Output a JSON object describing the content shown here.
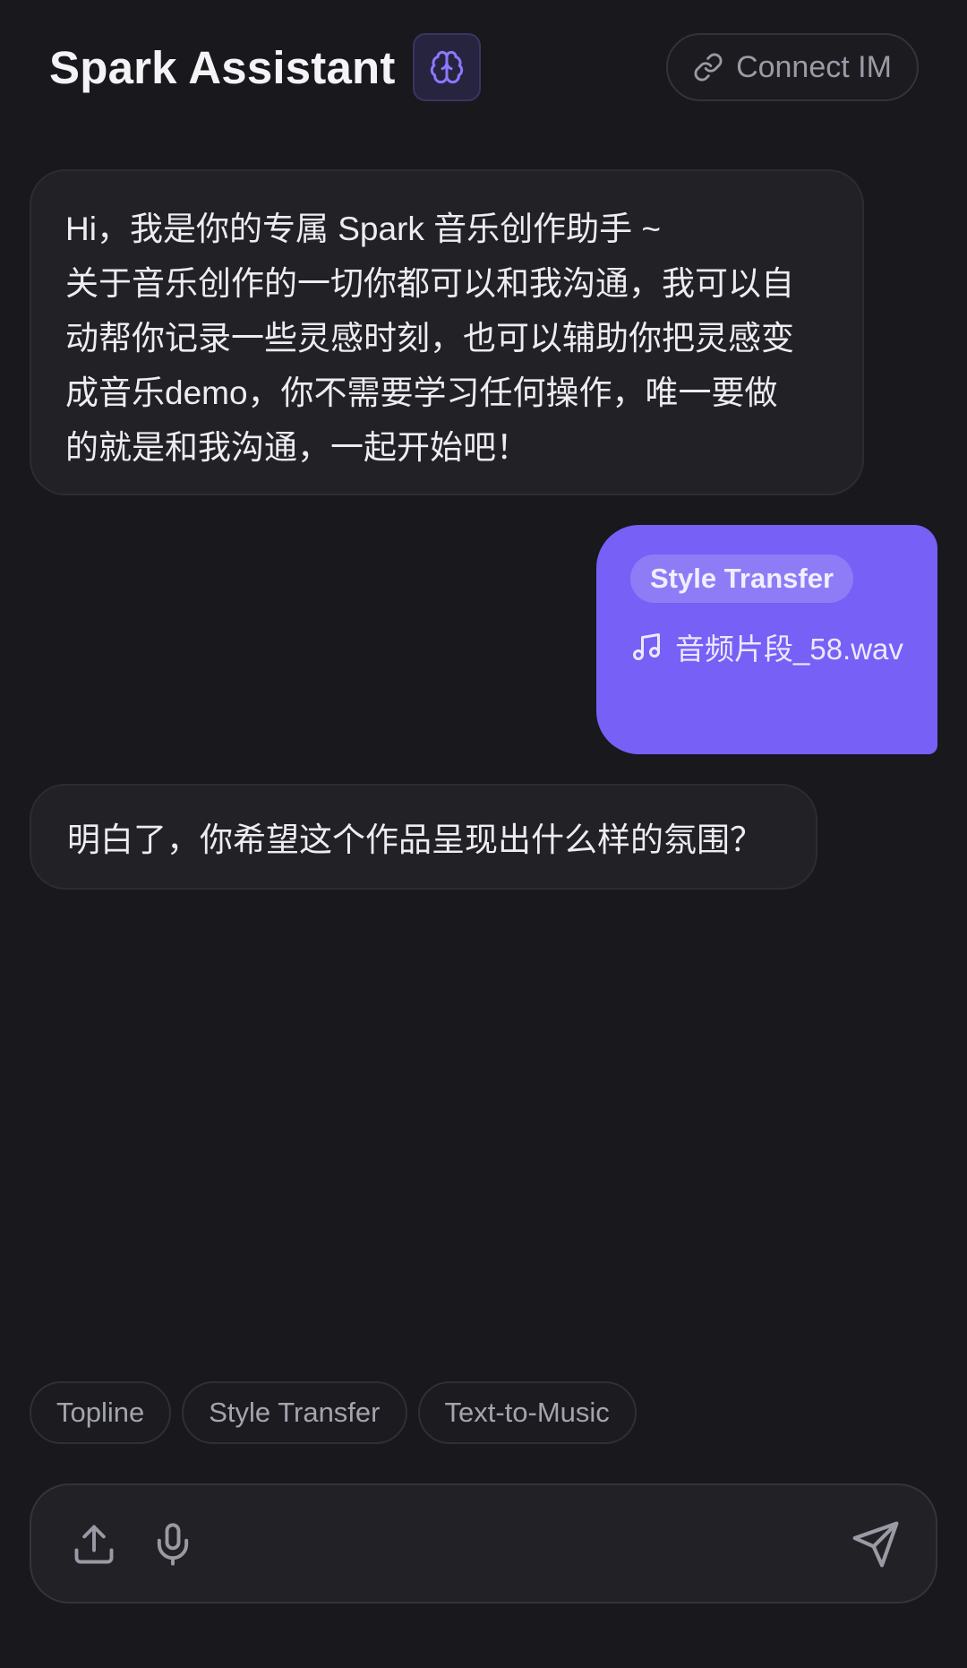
{
  "header": {
    "title": "Spark Assistant",
    "brain_icon": "brain-icon",
    "connect_label": "Connect IM",
    "connect_icon": "link-icon"
  },
  "messages": [
    {
      "role": "assistant",
      "lines": [
        "Hi，我是你的专属 Spark 音乐创作助手 ~",
        "关于音乐创作的一切你都可以和我沟通，我可以自",
        "动帮你记录一些灵感时刻，也可以辅助你把灵感变",
        "成音乐demo，你不需要学习任何操作，唯一要做",
        "的就是和我沟通，一起开始吧！"
      ]
    },
    {
      "role": "user",
      "tag": "Style Transfer",
      "attachment": {
        "icon": "music-note-icon",
        "name": "音频片段_58.wav"
      }
    },
    {
      "role": "assistant",
      "lines": [
        "明白了，你希望这个作品呈现出什么样的氛围？"
      ]
    }
  ],
  "quick_actions": [
    "Topline",
    "Style Transfer",
    "Text-to-Music"
  ],
  "input": {
    "value": "",
    "upload_icon": "upload-icon",
    "mic_icon": "microphone-icon",
    "send_icon": "send-icon"
  },
  "colors": {
    "background": "#18181d",
    "accent": "#7660f6",
    "bubble": "#212126"
  }
}
